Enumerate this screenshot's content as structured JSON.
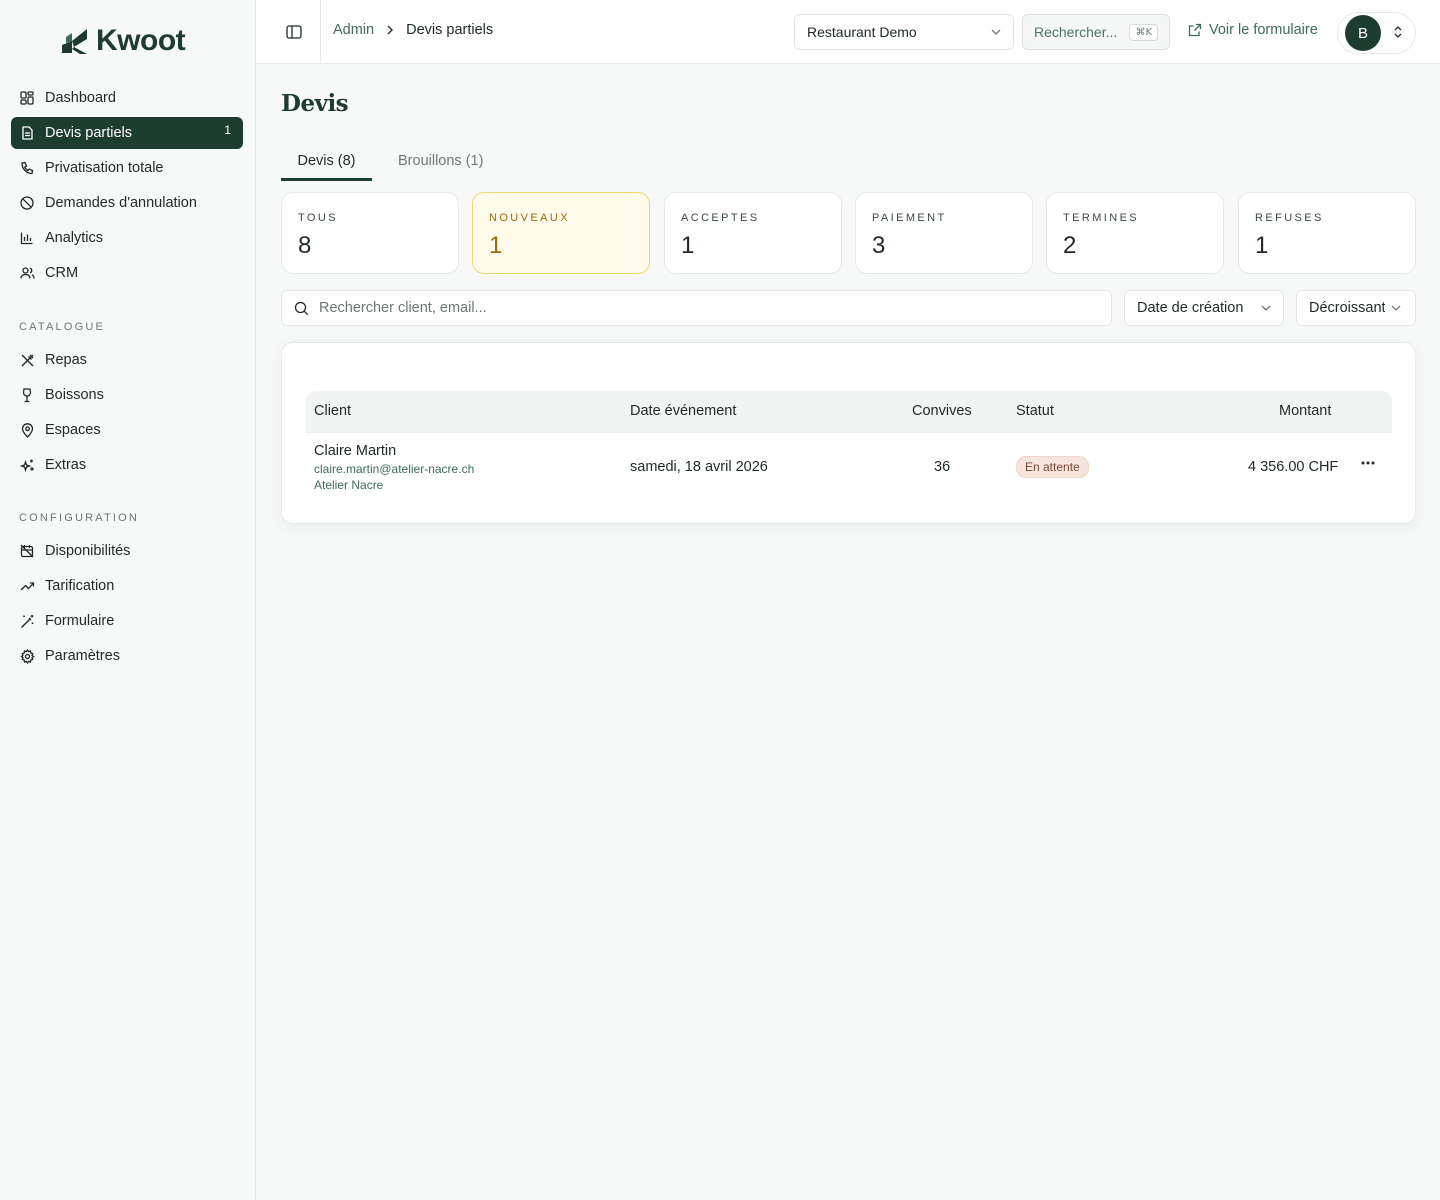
{
  "brand": {
    "name": "Kwoot"
  },
  "sidebar": {
    "main_items": [
      {
        "label": "Dashboard",
        "icon": "dashboard-icon"
      },
      {
        "label": "Devis partiels",
        "icon": "document-icon",
        "badge": "1",
        "active": true
      },
      {
        "label": "Privatisation totale",
        "icon": "phone-icon"
      },
      {
        "label": "Demandes d'annulation",
        "icon": "ban-icon"
      },
      {
        "label": "Analytics",
        "icon": "bar-chart-icon"
      },
      {
        "label": "CRM",
        "icon": "users-icon"
      }
    ],
    "catalogue_title": "CATALOGUE",
    "catalogue_items": [
      {
        "label": "Repas",
        "icon": "utensils-icon"
      },
      {
        "label": "Boissons",
        "icon": "wine-icon"
      },
      {
        "label": "Espaces",
        "icon": "map-pin-icon"
      },
      {
        "label": "Extras",
        "icon": "sparkles-icon"
      }
    ],
    "config_title": "CONFIGURATION",
    "config_items": [
      {
        "label": "Disponibilités",
        "icon": "calendar-off-icon"
      },
      {
        "label": "Tarification",
        "icon": "trending-up-icon"
      },
      {
        "label": "Formulaire",
        "icon": "magic-wand-icon"
      },
      {
        "label": "Paramètres",
        "icon": "gear-icon"
      }
    ]
  },
  "topbar": {
    "breadcrumb": {
      "root": "Admin",
      "current": "Devis partiels"
    },
    "restaurant_select": "Restaurant Demo",
    "search_placeholder": "Rechercher...",
    "search_shortcut": "⌘K",
    "view_form_link": "Voir le formulaire",
    "avatar_initial": "B"
  },
  "page": {
    "title": "Devis",
    "tabs": [
      {
        "label": "Devis (8)",
        "active": true
      },
      {
        "label": "Brouillons (1)",
        "active": false
      }
    ],
    "stat_cards": [
      {
        "label": "TOUS",
        "value": "8"
      },
      {
        "label": "NOUVEAUX",
        "value": "1",
        "highlight": true
      },
      {
        "label": "ACCEPTES",
        "value": "1"
      },
      {
        "label": "PAIEMENT",
        "value": "3"
      },
      {
        "label": "TERMINES",
        "value": "2"
      },
      {
        "label": "REFUSES",
        "value": "1"
      }
    ],
    "search_placeholder": "Rechercher client, email...",
    "sort_field": "Date de création",
    "sort_order": "Décroissant"
  },
  "table": {
    "headers": {
      "client": "Client",
      "date": "Date événement",
      "guests": "Convives",
      "status": "Statut",
      "amount": "Montant"
    },
    "rows": [
      {
        "client_name": "Claire Martin",
        "client_email": "claire.martin@atelier-nacre.ch",
        "client_company": "Atelier Nacre",
        "date": "samedi, 18 avril 2026",
        "guests": "36",
        "status": "En attente",
        "amount": "4 356.00 CHF"
      }
    ]
  },
  "colors": {
    "primary": "#1e3d31",
    "accent_green": "#3f6b58",
    "highlight_bg": "#fffbea",
    "highlight_border": "#f0d870",
    "highlight_text": "#9a6a0d",
    "status_bg": "#f6e4dc"
  }
}
